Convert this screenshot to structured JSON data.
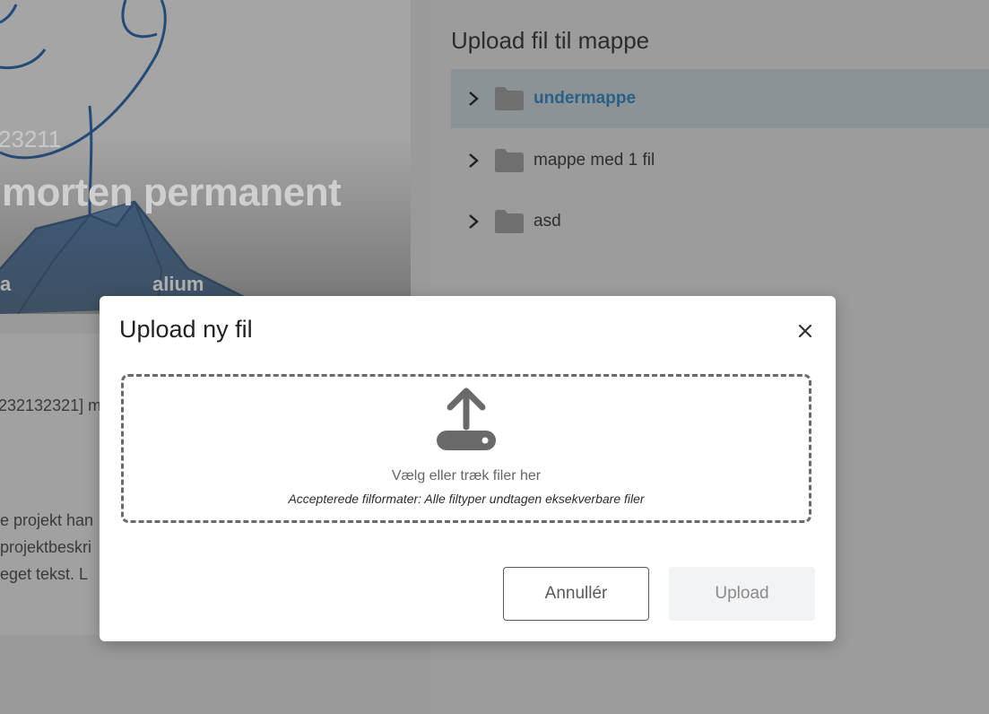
{
  "background": {
    "hero": {
      "id_text": "23211",
      "title": "morten permanent",
      "small_left": "a",
      "small_right": "alium"
    },
    "left_card": {
      "id_line": "232132321] m",
      "desc_lines": [
        "e projekt han",
        "projektbeskri",
        "eget tekst. L"
      ]
    },
    "right_panel": {
      "title": "Upload fil til mappe",
      "folders": [
        {
          "label": "undermappe",
          "selected": true,
          "icon": "folder-icon",
          "toggle_icon": "chevron-right-icon"
        },
        {
          "label": "mappe med 1 fil",
          "selected": false,
          "icon": "folder-icon",
          "toggle_icon": "chevron-right-icon"
        },
        {
          "label": "asd",
          "selected": false,
          "icon": "folder-icon",
          "toggle_icon": "chevron-right-icon"
        }
      ]
    }
  },
  "modal": {
    "title": "Upload ny fil",
    "close_icon": "close-icon",
    "dropzone": {
      "icon": "upload-icon",
      "primary_text": "Vælg eller træk filer her",
      "secondary_text": "Accepterede filformater: Alle filtyper undtagen eksekverbare filer"
    },
    "cancel_label": "Annullér",
    "upload_label": "Upload"
  },
  "colors": {
    "overlay": "#9a9a9a",
    "selected_folder_text": "#2a5f86",
    "modal_bg": "#ffffff",
    "upload_btn_bg": "#f2f3f5"
  }
}
